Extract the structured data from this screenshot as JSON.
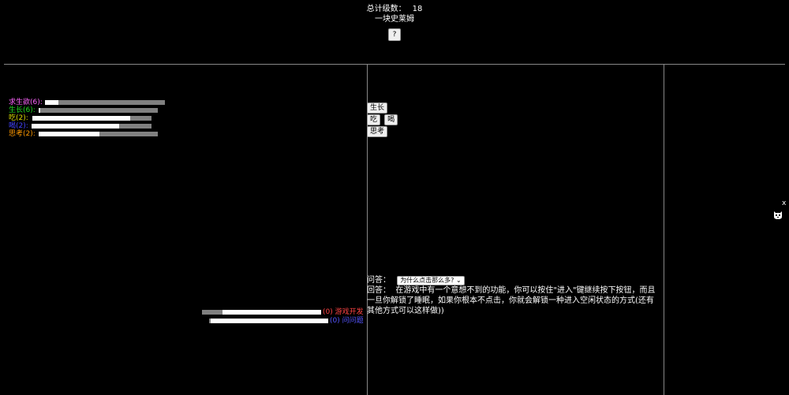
{
  "header": {
    "total_label": "总计级数：",
    "total_value": "18",
    "title": "一块史莱姆",
    "help_label": "?"
  },
  "stats": [
    {
      "label": "求生欲(6):",
      "color": "#ff66ff",
      "progress": 0.11
    },
    {
      "label": "生长(6):",
      "color": "#22dd22",
      "progress": 0.01
    },
    {
      "label": "吃(2):",
      "color": "#dddd00",
      "progress": 0.82
    },
    {
      "label": "喝(2):",
      "color": "#4444ff",
      "progress": 0.73
    },
    {
      "label": "思考(2):",
      "color": "#ff9900",
      "progress": 0.51
    }
  ],
  "dev_tasks": [
    {
      "count": "(0)",
      "label": "游戏开发",
      "color": "#ff4444",
      "progress": 0.83
    },
    {
      "count": "(0)",
      "label": "问问题",
      "color": "#5555ff",
      "progress": 0.99
    }
  ],
  "actions": {
    "grow": "生长",
    "eat": "吃",
    "drink": "喝",
    "think": "思考"
  },
  "qa": {
    "question_label": "问答：",
    "selected_question": "为什么点击那么多?",
    "answer_label": "回答：",
    "answer_text": "在游戏中有一个意想不到的功能，你可以按住\"进入\"键继续按下按钮，而且一旦你解锁了睡眠，如果你根本不点击，你就会解锁一种进入空闲状态的方式(还有其他方式可以这样做))"
  },
  "side": {
    "close_label": "x",
    "icon": "cat-icon"
  }
}
